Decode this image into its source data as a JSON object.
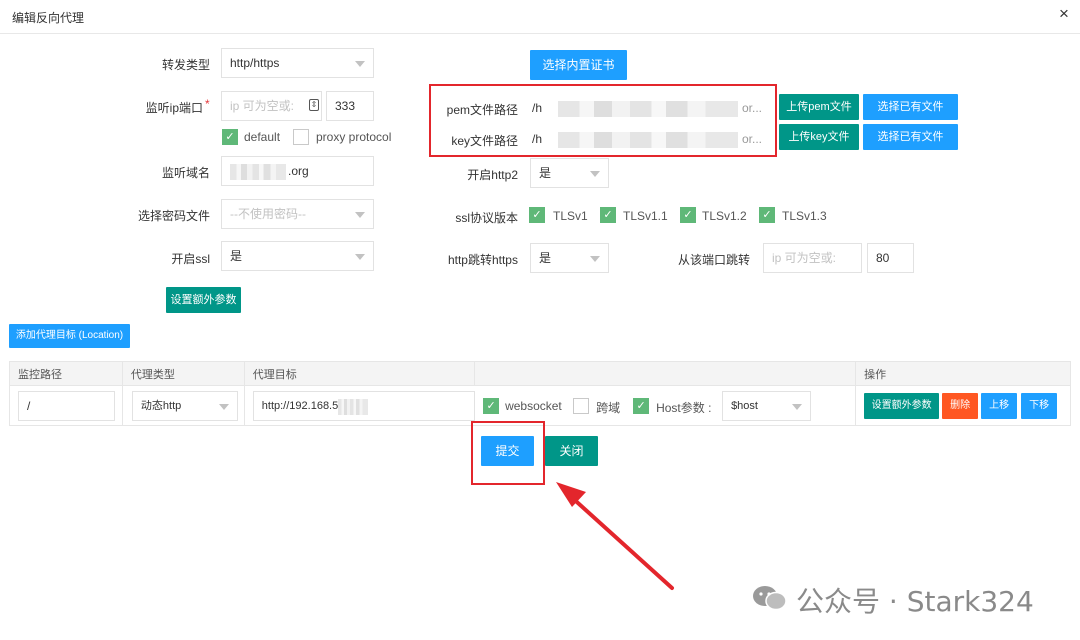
{
  "dialog": {
    "title": "编辑反向代理",
    "close_icon": "×"
  },
  "left": {
    "forward_type": {
      "label": "转发类型",
      "value": "http/https"
    },
    "listen_ip_port": {
      "label": "监听ip端口",
      "required_mark": "*",
      "ip_placeholder": "ip 可为空或:",
      "port_value": "333"
    },
    "default_checkbox": {
      "label": "default",
      "checked": true
    },
    "proxy_protocol_checkbox": {
      "label": "proxy protocol",
      "checked": false
    },
    "listen_domain": {
      "label": "监听域名",
      "value_suffix": ".org"
    },
    "password_file": {
      "label": "选择密码文件",
      "placeholder": "--不使用密码--"
    },
    "enable_ssl": {
      "label": "开启ssl",
      "value": "是"
    },
    "extra_params_button": "设置额外参数"
  },
  "right": {
    "builtin_cert_button": "选择内置证书",
    "pem_path": {
      "label": "pem文件路径",
      "value_prefix": "/h",
      "value_suffix": "or...",
      "upload_button": "上传pem文件",
      "select_button": "选择已有文件"
    },
    "key_path": {
      "label": "key文件路径",
      "value_prefix": "/h",
      "value_suffix": "or...",
      "upload_button": "上传key文件",
      "select_button": "选择已有文件"
    },
    "http2": {
      "label": "开启http2",
      "value": "是"
    },
    "ssl_protocol": {
      "label": "ssl协议版本",
      "options": [
        "TLSv1",
        "TLSv1.1",
        "TLSv1.2",
        "TLSv1.3"
      ]
    },
    "http_redirect": {
      "label": "http跳转https",
      "value": "是"
    },
    "redirect_port": {
      "label": "从该端口跳转",
      "ip_placeholder": "ip 可为空或:",
      "port_value": "80"
    }
  },
  "location": {
    "add_button": "添加代理目标 (Location)",
    "headers": [
      "监控路径",
      "代理类型",
      "代理目标",
      "",
      "操作"
    ],
    "row": {
      "path": "/",
      "type": "动态http",
      "target": "http://192.168.5(",
      "websocket": {
        "label": "websocket",
        "checked": true
      },
      "cross_domain": {
        "label": "跨域",
        "checked": false
      },
      "host_param": {
        "label": "Host参数 :",
        "checked": true,
        "value": "$host"
      },
      "actions": {
        "extra": "设置额外参数",
        "delete": "删除",
        "up": "上移",
        "down": "下移"
      }
    }
  },
  "footer": {
    "submit": "提交",
    "close": "关闭"
  },
  "watermark": "公众号 · Stark324",
  "colors": {
    "green": "#009688",
    "blue": "#1e9fff",
    "orange": "#ff5722",
    "annotation_red": "#e3262c",
    "check_green": "#5fb878"
  }
}
